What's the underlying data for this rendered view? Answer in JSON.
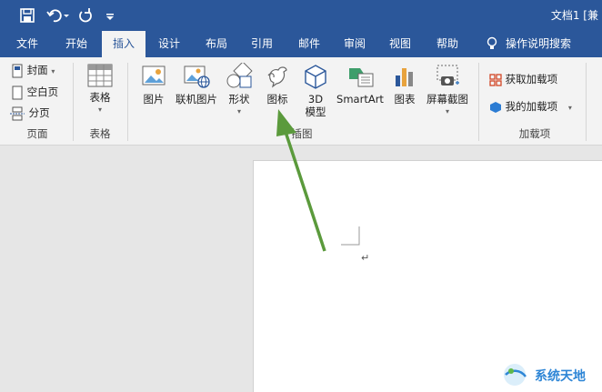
{
  "window": {
    "title": "文档1 [兼"
  },
  "qat": {
    "save": "save-icon",
    "undo": "undo-icon",
    "redo": "redo-icon",
    "customize": "customize-icon"
  },
  "tabs": [
    {
      "label": "文件"
    },
    {
      "label": "开始"
    },
    {
      "label": "插入",
      "active": true
    },
    {
      "label": "设计"
    },
    {
      "label": "布局"
    },
    {
      "label": "引用"
    },
    {
      "label": "邮件"
    },
    {
      "label": "审阅"
    },
    {
      "label": "视图"
    },
    {
      "label": "帮助"
    },
    {
      "label": "操作说明搜索"
    }
  ],
  "ribbon": {
    "pages": {
      "cover": "封面",
      "blank": "空白页",
      "break": "分页",
      "group": "页面"
    },
    "tables": {
      "table": "表格",
      "group": "表格"
    },
    "illustrations": {
      "picture": "图片",
      "online": "联机图片",
      "shapes": "形状",
      "icons": "图标",
      "model3d_1": "3D",
      "model3d_2": "模型",
      "smartart": "SmartArt",
      "chart": "图表",
      "screenshot": "屏幕截图",
      "group": "插图"
    },
    "addins": {
      "get": "获取加载项",
      "mine": "我的加载项",
      "group": "加载项"
    }
  },
  "document": {
    "paragraph_mark": "↵"
  },
  "watermark": {
    "text": "系统天地"
  },
  "colors": {
    "brand": "#2b579a",
    "arrow": "#5b9a3c"
  }
}
